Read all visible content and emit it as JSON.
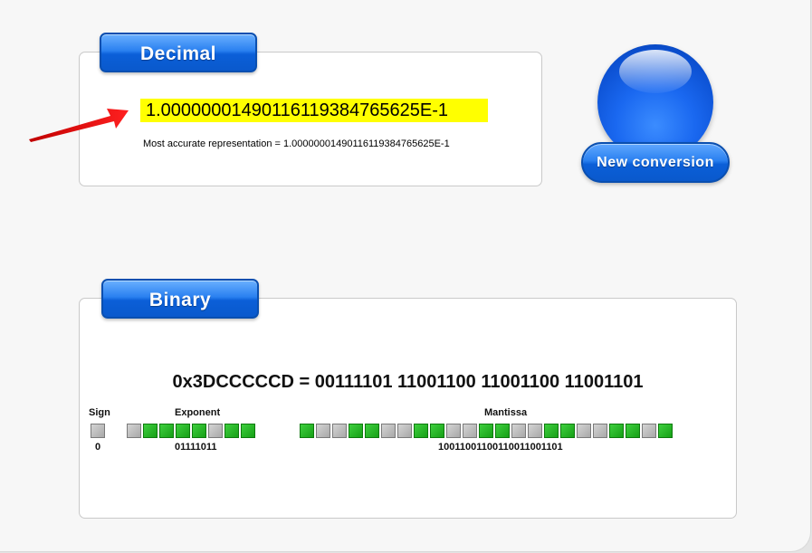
{
  "decimal": {
    "tab_label": "Decimal",
    "value": "1.00000001490116119384765625E-1",
    "accurate_text": "Most accurate representation = 1.00000001490116119384765625E-1"
  },
  "new_conversion_label": "New conversion",
  "binary": {
    "tab_label": "Binary",
    "hex_line": "0x3DCCCCCD = 00111101 11001100 11001100 11001101",
    "sign_label": "Sign",
    "exponent_label": "Exponent",
    "mantissa_label": "Mantissa",
    "sign_value": "0",
    "exponent_value": "01111011",
    "mantissa_value": "10011001100110011001101"
  },
  "colors": {
    "highlight": "#ffff00",
    "bit_on": "#22b022",
    "bit_off": "#b4b4b4",
    "button_blue": "#1a6ee8",
    "arrow": "#e81010"
  },
  "icons": {
    "arrow": "red-arrow-icon",
    "orb": "blue-orb-icon"
  }
}
